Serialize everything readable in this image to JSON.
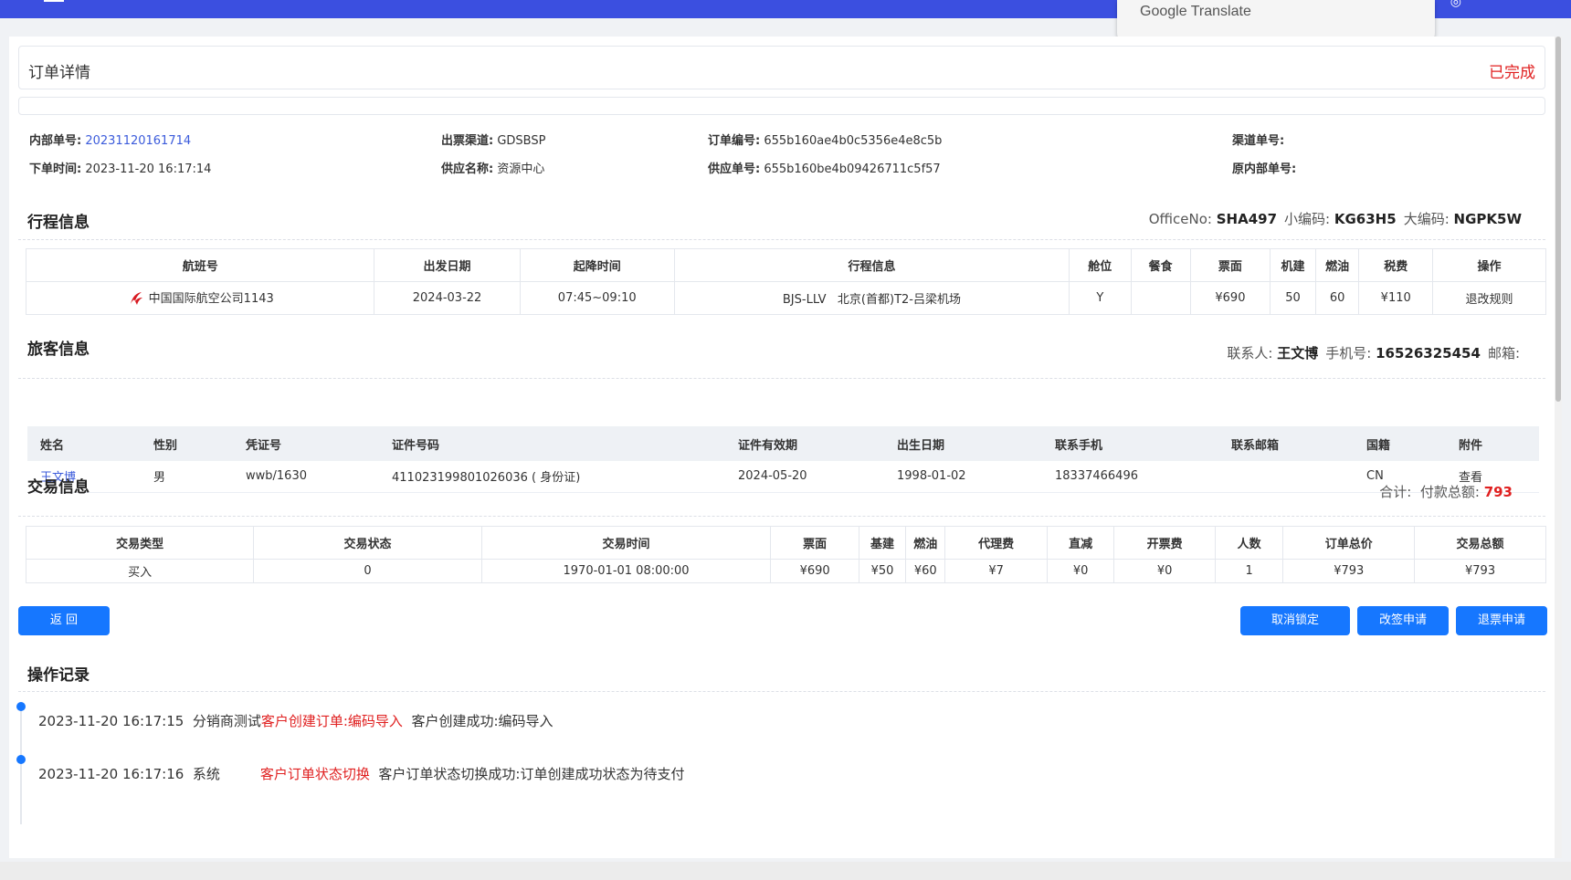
{
  "page": {
    "title": "订单详情",
    "status": "已完成"
  },
  "translate_popup": {
    "label": "Google Translate"
  },
  "info": {
    "internal_no_label": "内部单号:",
    "internal_no": "20231120161714",
    "ticket_channel_label": "出票渠道:",
    "ticket_channel": "GDSBSP",
    "order_no_label": "订单编号:",
    "order_no": "655b160ae4b0c5356e4e8c5b",
    "channel_no_label": "渠道单号:",
    "channel_no": "",
    "order_time_label": "下单时间:",
    "order_time": "2023-11-20 16:17:14",
    "supplier_label": "供应名称:",
    "supplier": "资源中心",
    "supply_no_label": "供应单号:",
    "supply_no": "655b160be4b09426711c5f57",
    "orig_internal_label": "原内部单号:",
    "orig_internal": ""
  },
  "itinerary": {
    "title": "行程信息",
    "office_label": "OfficeNo:",
    "office": "SHA497",
    "small_code_label": "小编码:",
    "small_code": "KG63H5",
    "big_code_label": "大编码:",
    "big_code": "NGPK5W",
    "headers": [
      "航班号",
      "出发日期",
      "起降时间",
      "行程信息",
      "舱位",
      "餐食",
      "票面",
      "机建",
      "燃油",
      "税费",
      "操作"
    ],
    "row": {
      "flight": "中国国际航空公司1143",
      "date": "2024-03-22",
      "time": "07:45~09:10",
      "route": "BJS-LLV   北京(首都)T2-吕梁机场",
      "cabin": "Y",
      "meal": "",
      "fare": "¥690",
      "airport_fee": "50",
      "fuel": "60",
      "tax": "¥110",
      "action": "退改规则"
    }
  },
  "passenger": {
    "title": "旅客信息",
    "contact_label": "联系人:",
    "contact": "王文博",
    "phone_label": "手机号:",
    "phone": "16526325454",
    "email_label": "邮箱:",
    "email": "",
    "headers": [
      "姓名",
      "性别",
      "凭证号",
      "证件号码",
      "证件有效期",
      "出生日期",
      "联系手机",
      "联系邮箱",
      "国籍",
      "附件"
    ],
    "row": {
      "name": "王文博",
      "gender": "男",
      "voucher": "wwb/1630",
      "id_no": "411023199801026036 ( 身份证)",
      "id_expiry": "2024-05-20",
      "birth": "1998-01-02",
      "mobile": "18337466496",
      "email": "",
      "nationality": "CN",
      "attachment": "查看"
    }
  },
  "transaction": {
    "title": "交易信息",
    "total_label": "合计:",
    "pay_label": "付款总额:",
    "pay_total": "793",
    "headers": [
      "交易类型",
      "交易状态",
      "交易时间",
      "票面",
      "基建",
      "燃油",
      "代理费",
      "直减",
      "开票费",
      "人数",
      "订单总价",
      "交易总额"
    ],
    "row": {
      "type": "买入",
      "status": "0",
      "time": "1970-01-01 08:00:00",
      "fare": "¥690",
      "airport": "¥50",
      "fuel": "¥60",
      "agent_fee": "¥7",
      "discount": "¥0",
      "ticket_fee": "¥0",
      "people": "1",
      "order_total": "¥793",
      "trade_total": "¥793"
    }
  },
  "buttons": {
    "back": "返 回",
    "cancel_lock": "取消锁定",
    "change": "改签申请",
    "refund": "退票申请"
  },
  "log": {
    "title": "操作记录",
    "entries": [
      {
        "time": "2023-11-20 16:17:15",
        "operator": "分销商测试",
        "action": "客户创建订单:编码导入",
        "detail": "客户创建成功:编码导入"
      },
      {
        "time": "2023-11-20 16:17:16",
        "operator": "系统",
        "action": "客户订单状态切换",
        "detail": "客户订单状态切换成功:订单创建成功状态为待支付"
      }
    ]
  },
  "colors": {
    "accent": "#1677ff",
    "status": "#e02020",
    "topbar": "#3b4fe0"
  }
}
